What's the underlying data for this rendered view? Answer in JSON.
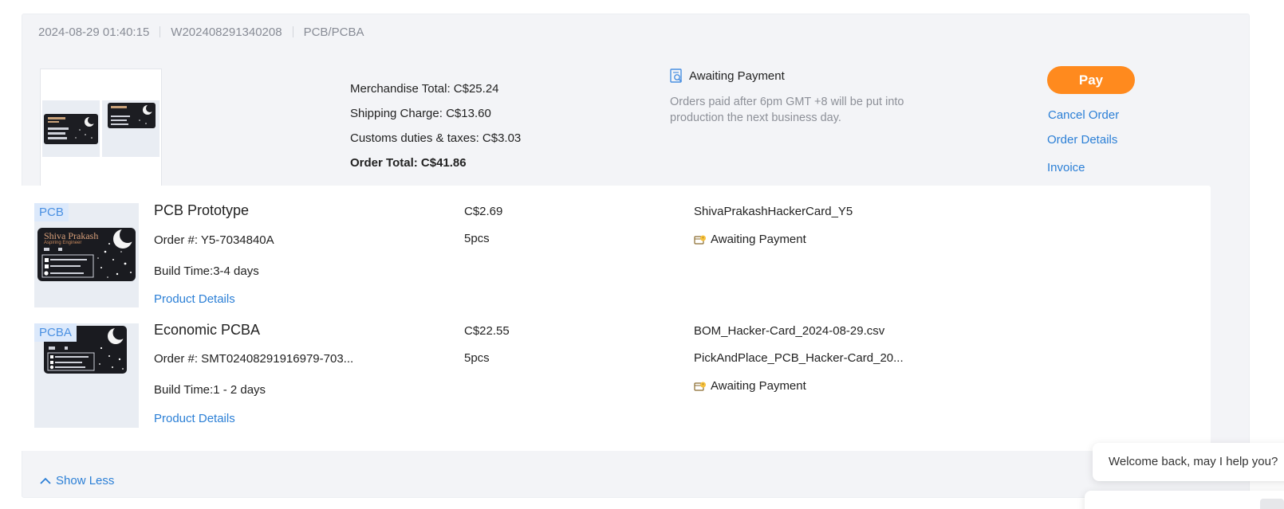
{
  "order": {
    "datetime": "2024-08-29 01:40:15",
    "order_number": "W202408291340208",
    "category": "PCB/PCBA"
  },
  "totals": {
    "merchandise": "Merchandise Total: C$25.24",
    "shipping": "Shipping Charge: C$13.60",
    "customs": "Customs duties & taxes: C$3.03",
    "order_total": "Order Total: C$41.86"
  },
  "status": {
    "label": "Awaiting Payment",
    "note": "Orders paid after 6pm GMT +8 will be put into production the next business day."
  },
  "actions": {
    "pay": "Pay",
    "cancel": "Cancel Order",
    "details": "Order Details",
    "invoice": "Invoice"
  },
  "items": [
    {
      "tag": "PCB",
      "name": "PCB Prototype",
      "order_no": "Order #: Y5-7034840A",
      "build_time": "Build Time:3-4 days",
      "details_link": "Product Details",
      "price": "C$2.69",
      "qty": "5pcs",
      "file": "ShivaPrakashHackerCard_Y5",
      "status": "Awaiting Payment",
      "card_name": "Shiva Prakash",
      "card_sub": "Aspiring Engineer"
    },
    {
      "tag": "PCBA",
      "name": "Economic PCBA",
      "order_no": "Order #: SMT02408291916979-703...",
      "build_time": "Build Time:1 - 2 days",
      "details_link": "Product Details",
      "price": "C$22.55",
      "qty": "5pcs",
      "file1": "BOM_Hacker-Card_2024-08-29.csv",
      "file2": "PickAndPlace_PCB_Hacker-Card_20...",
      "status": "Awaiting Payment"
    }
  ],
  "show_less": "Show Less",
  "chat": {
    "welcome": "Welcome back, may I help you?"
  },
  "colors": {
    "accent": "#2b7fd6",
    "pay": "#ff8a1e",
    "tag_bg": "#dce9fb"
  }
}
